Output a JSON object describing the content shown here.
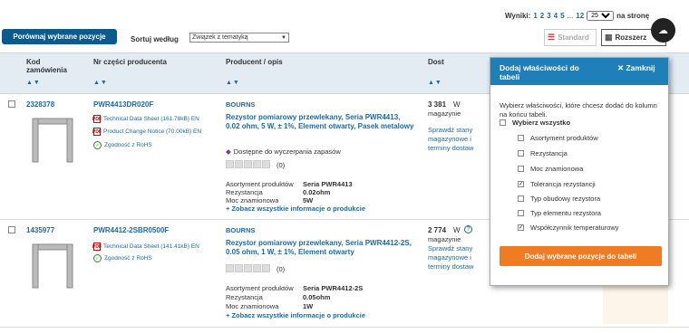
{
  "pagination": {
    "label": "Wyniki:",
    "pages": [
      "1",
      "2",
      "3",
      "4",
      "5"
    ],
    "ellipsis": "...",
    "last_page": "12",
    "per_page": "25",
    "per_page_suffix": "na stronę"
  },
  "toolbar": {
    "compare_label": "Porównaj wybrane pozycje",
    "sort_label": "Sortuj według",
    "sort_value": "Związek z tematyką",
    "view_standard": "Standard",
    "view_detail": "Rozszerz"
  },
  "columns": {
    "code": "Kod zamówienia",
    "part": "Nr części producenta",
    "producer": "Producent / opis",
    "availability": "Dost"
  },
  "products": [
    {
      "code": "2328378",
      "part": "PWR4413DR020F",
      "docs": [
        "Technical Data Sheet (161.78kB) EN",
        "Product Change Notice (70.00kB) EN"
      ],
      "rohs": "Zgodność z RoHS",
      "brand": "BOURNS",
      "description": "Rezystor pomiarowy przewlekany, Seria PWR4413, 0.02 ohm, 5 W, ± 1%, Element otwarty, Pasek metalowy",
      "note": "Dostępne do wyczerpania zapasów",
      "rating_count": "(0)",
      "attrs": [
        {
          "label": "Asortyment produktów",
          "value": "Seria PWR4413"
        },
        {
          "label": "Rezystancja",
          "value": "0.02ohm"
        },
        {
          "label": "Moc znamionowa",
          "value": "5W"
        }
      ],
      "more_link": "+ Zobacz wszystkie informacje o produkcie",
      "stock": "3 381",
      "stock_unit": "W",
      "stock_place": "magazynie",
      "stock_link": "Sprawdź stany magazynowe i terminy dostaw"
    },
    {
      "code": "1435977",
      "part": "PWR4412-2SBR0500F",
      "docs": [
        "Technical Data Sheet (141.41kB) EN"
      ],
      "rohs": "Zgodność z RoHS",
      "brand": "BOURNS",
      "description": "Rezystor pomiarowy przewlekany, Seria PWR4412-2S, 0.05 ohm, 1 W, ± 1%, Element otwarty",
      "note": "",
      "rating_count": "(0)",
      "attrs": [
        {
          "label": "Asortyment produktów",
          "value": "Seria PWR4412-2S"
        },
        {
          "label": "Rezystancja",
          "value": "0.05ohm"
        },
        {
          "label": "Moc znamionowa",
          "value": "1W"
        }
      ],
      "more_link": "+ Zobacz wszystkie informacje o produkcie",
      "stock": "2 774",
      "stock_unit": "W",
      "stock_place": "magazynie",
      "stock_link": "Sprawdź stany magazynowe i terminy dostaw"
    }
  ],
  "panel": {
    "title": "Dodaj właściwości do tabeli",
    "close": "Zamknij",
    "description": "Wybierz właściwości, które chcesz dodać do kolumn na końcu tabeli.",
    "select_all": "Wybierz wszystko",
    "options": [
      {
        "label": "Asortyment produktów",
        "checked": false
      },
      {
        "label": "Rezystancja",
        "checked": false
      },
      {
        "label": "Moc znamionowa",
        "checked": false
      },
      {
        "label": "Tolerancja rezystancji",
        "checked": true
      },
      {
        "label": "Typ obudowy rezystora",
        "checked": false
      },
      {
        "label": "Typ elementu rezystora",
        "checked": false
      },
      {
        "label": "Współczynnik temperaturowy",
        "checked": true
      }
    ],
    "add_button": "Dodaj wybrane pozycje do tabeli"
  }
}
